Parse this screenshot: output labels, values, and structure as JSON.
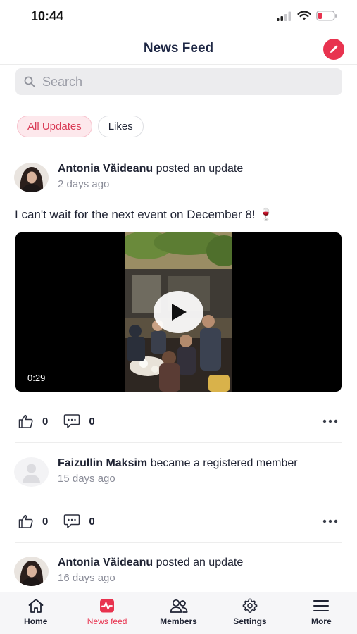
{
  "status_bar": {
    "time": "10:44"
  },
  "header": {
    "title": "News Feed"
  },
  "search": {
    "placeholder": "Search"
  },
  "tabs": [
    {
      "label": "All Updates",
      "active": true
    },
    {
      "label": "Likes",
      "active": false
    }
  ],
  "posts": [
    {
      "author": "Antonia Văideanu",
      "action": "posted an update",
      "time": "2 days ago",
      "text": "I can't wait for the next event on December 8! 🍷",
      "video_duration": "0:29",
      "likes": "0",
      "comments": "0"
    },
    {
      "author": "Faizullin Maksim",
      "action": "became a registered member",
      "time": "15 days ago",
      "likes": "0",
      "comments": "0"
    },
    {
      "author": "Antonia Văideanu",
      "action": "posted an update",
      "time": "16 days ago"
    }
  ],
  "bottom_nav": [
    {
      "label": "Home",
      "icon": "home-icon",
      "active": false
    },
    {
      "label": "News feed",
      "icon": "activity-icon",
      "active": true
    },
    {
      "label": "Members",
      "icon": "members-icon",
      "active": false
    },
    {
      "label": "Settings",
      "icon": "gear-icon",
      "active": false
    },
    {
      "label": "More",
      "icon": "menu-icon",
      "active": false
    }
  ],
  "colors": {
    "accent": "#e8334f",
    "tab_active_bg": "#fde8ec",
    "text": "#1f2333",
    "muted": "#8b8d99"
  }
}
